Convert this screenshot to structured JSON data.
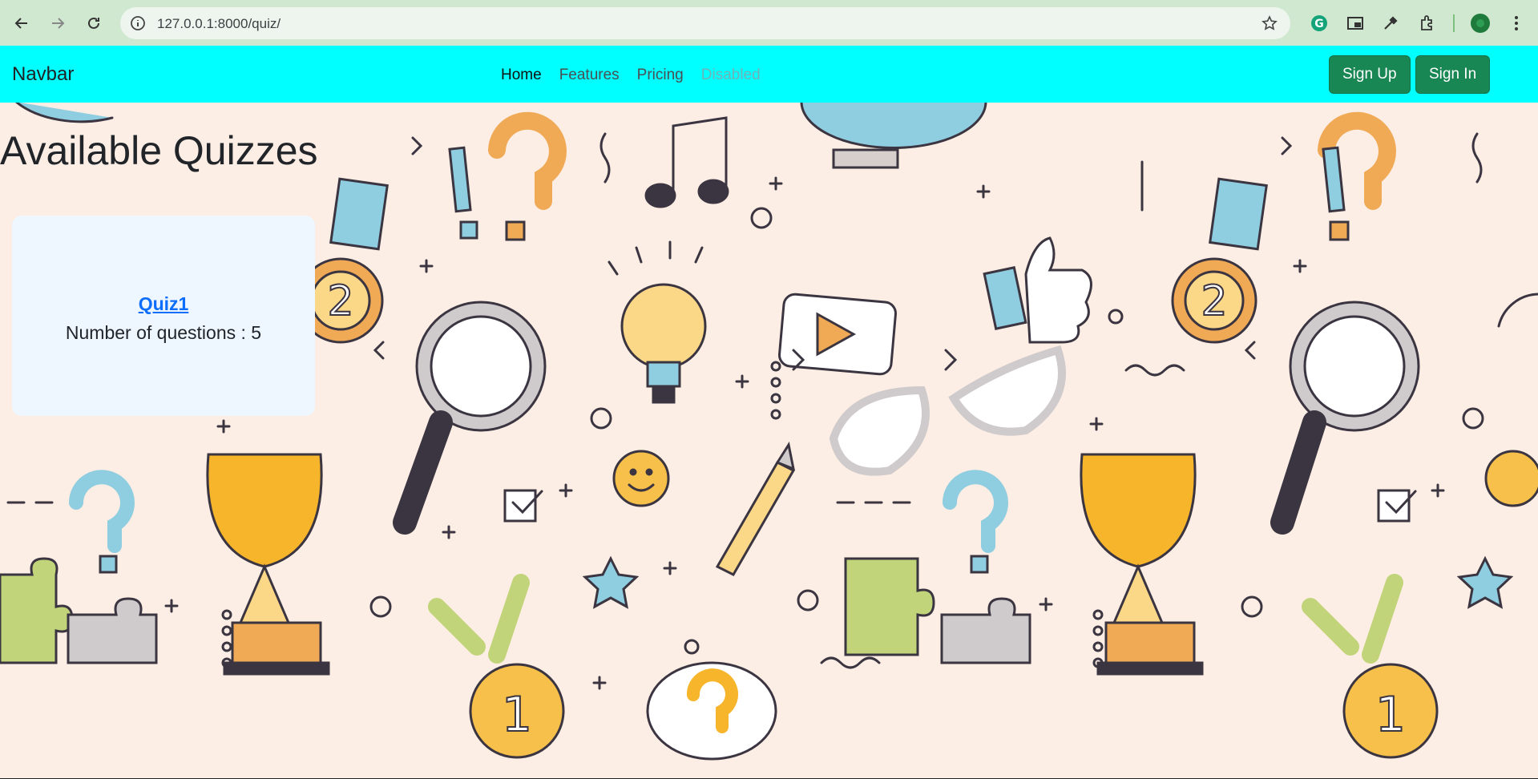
{
  "browser": {
    "url": "127.0.0.1:8000/quiz/"
  },
  "navbar": {
    "brand": "Navbar",
    "links": [
      "Home",
      "Features",
      "Pricing",
      "Disabled"
    ],
    "buttons": {
      "signup": "Sign Up",
      "signin": "Sign In"
    }
  },
  "main": {
    "title": "Available Quizzes",
    "quizzes": [
      {
        "name": "Quiz1",
        "count_label": "Number of questions : 5"
      }
    ]
  },
  "colors": {
    "navbar_bg": "#00ffff",
    "button_bg": "#198754",
    "link": "#0d6efd",
    "card_bg": "#eef6ff",
    "page_bg": "#fceee4"
  },
  "icons": [
    "back-icon",
    "forward-icon",
    "reload-icon",
    "site-info-icon",
    "bookmark-star-icon",
    "grammarly-icon",
    "picture-in-picture-icon",
    "eyedropper-icon",
    "extensions-icon",
    "profile-avatar",
    "menu-kebab-icon"
  ]
}
